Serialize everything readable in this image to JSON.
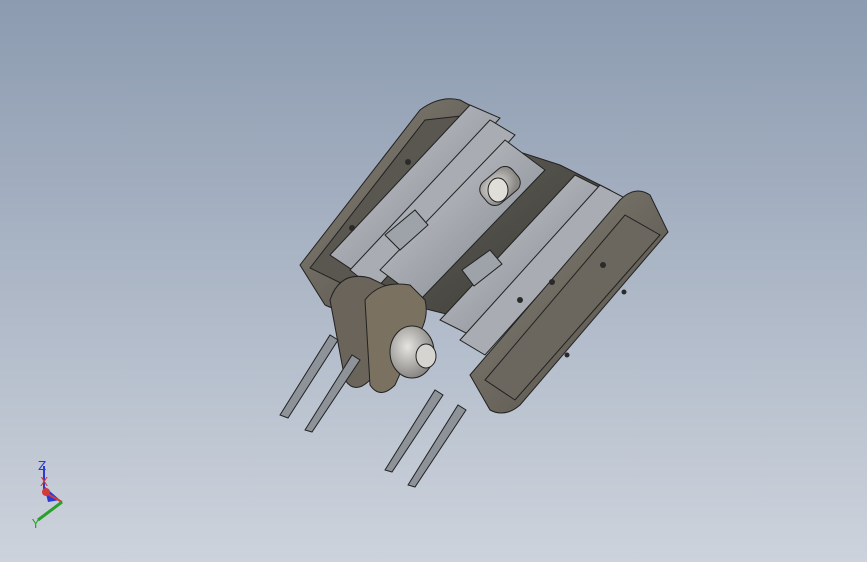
{
  "viewport": {
    "background_top": "#8c9bb0",
    "background_bottom": "#cdd3dc"
  },
  "model": {
    "part_colors": {
      "housing": "#6e6a62",
      "housing_dark": "#4a4740",
      "plate": "#9aa0a8",
      "plate_light": "#c4c8cc",
      "shaft": "#b8b6b2",
      "bronze": "#7a7160"
    }
  },
  "triad": {
    "x_label": "X",
    "y_label": "Y",
    "z_label": "Z",
    "x_color": "#d43a3a",
    "y_color": "#2aa02a",
    "z_color": "#2a3ad4"
  }
}
